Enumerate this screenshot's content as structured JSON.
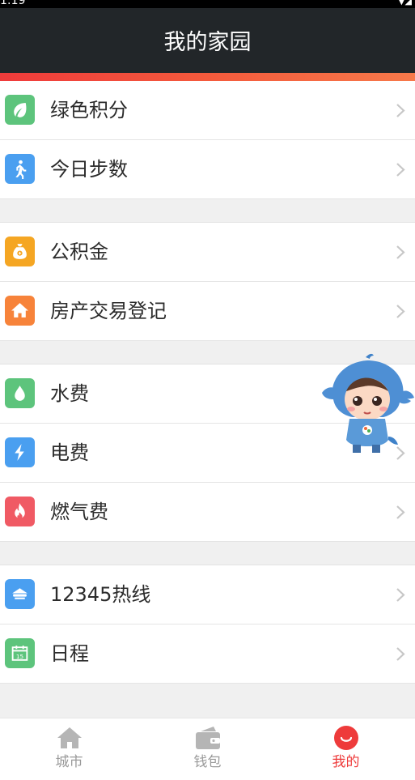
{
  "status_bar": {
    "time": "1:19",
    "indicators": "▼◢"
  },
  "header": {
    "title": "我的家园"
  },
  "colors": {
    "header_bg": "#222629",
    "accent": "#ee3b3b",
    "chevron": "#c7c7c7"
  },
  "groups": [
    {
      "items": [
        {
          "label": "绿色积分",
          "icon": "leaf-icon",
          "color": "#5dc47c"
        },
        {
          "label": "今日步数",
          "icon": "walk-icon",
          "color": "#4a9ff0"
        }
      ]
    },
    {
      "items": [
        {
          "label": "公积金",
          "icon": "moneybag-icon",
          "color": "#f5a623"
        },
        {
          "label": "房产交易登记",
          "icon": "house-icon",
          "color": "#f7833a"
        }
      ]
    },
    {
      "items": [
        {
          "label": "水费",
          "icon": "water-drop-icon",
          "color": "#5dc47c"
        },
        {
          "label": "电费",
          "icon": "lightning-icon",
          "color": "#4a9ff0"
        },
        {
          "label": "燃气费",
          "icon": "flame-icon",
          "color": "#f05a64"
        }
      ]
    },
    {
      "items": [
        {
          "label": "12345热线",
          "icon": "hotline-icon",
          "color": "#4a9ff0"
        },
        {
          "label": "日程",
          "icon": "calendar-icon",
          "color": "#5dc47c",
          "icon_text": "15"
        }
      ]
    }
  ],
  "tabbar": {
    "tabs": [
      {
        "label": "城市",
        "icon": "city-home-icon",
        "active": false
      },
      {
        "label": "钱包",
        "icon": "wallet-icon",
        "active": false
      },
      {
        "label": "我的",
        "icon": "mine-smile-icon",
        "active": true
      }
    ]
  }
}
